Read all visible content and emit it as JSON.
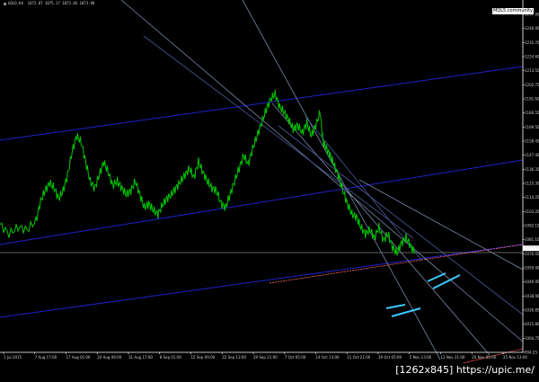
{
  "header": {
    "symbol_line": "GOLD,H4  1072.87 1075.17 1073.46 1073.90",
    "broker_tag": "MQL5.community",
    "watermark": "[1262x845] https://upic.me/"
  },
  "colors": {
    "background": "#000000",
    "price_line": "#00c800",
    "channel_blue": "#2020c8",
    "trend_grey": "#7888a8",
    "bid_line": "#808080",
    "pink_line": "#ff6c6c",
    "marker_cyan": "#3cc8ff",
    "axis": "#ffffff"
  },
  "chart_data": {
    "type": "line",
    "symbol": "GOLD",
    "timeframe": "H4",
    "ohlc": {
      "open": 1072.87,
      "high": 1075.17,
      "low": 1073.46,
      "close": 1073.9
    },
    "current_price": 1073.9,
    "y_range": [
      994.25,
      1257.0
    ],
    "y_ticks": [
      "1257.00",
      "1246.95",
      "1235.70",
      "1224.60",
      "1213.50",
      "1202.75",
      "1191.60",
      "1180.55",
      "1169.50",
      "1158.45",
      "1147.40",
      "1136.35",
      "1125.30",
      "1114.25",
      "1103.20",
      "1092.15",
      "1081.10",
      "1070.05",
      "1059.00",
      "1049.95",
      "1038.90",
      "1026.85",
      "1015.80",
      "1004.75",
      "994.25"
    ],
    "x_ticks": [
      "1 Jul 2015",
      "7 Aug 17:00",
      "17 Aug 01:00",
      "24 Aug 09:00",
      "31 Aug 17:00",
      "8 Sep 01:00",
      "15 Sep 09:00",
      "22 Sep 13:00",
      "29 Sep 21:00",
      "7 Oct 05:00",
      "14 Oct 13:00",
      "21 Oct 21:00",
      "29 Oct 05:00",
      "5 Nov 13:00",
      "12 Nov 21:00",
      "20 Nov 05:00",
      "25 Nov 13:00"
    ],
    "price_series": [
      [
        0,
        1092
      ],
      [
        10,
        1085
      ],
      [
        20,
        1090
      ],
      [
        30,
        1088
      ],
      [
        40,
        1095
      ],
      [
        45,
        1110
      ],
      [
        50,
        1118
      ],
      [
        55,
        1124
      ],
      [
        60,
        1120
      ],
      [
        65,
        1112
      ],
      [
        70,
        1118
      ],
      [
        75,
        1130
      ],
      [
        80,
        1148
      ],
      [
        85,
        1160
      ],
      [
        90,
        1155
      ],
      [
        95,
        1140
      ],
      [
        100,
        1125
      ],
      [
        105,
        1120
      ],
      [
        110,
        1130
      ],
      [
        115,
        1140
      ],
      [
        120,
        1132
      ],
      [
        125,
        1122
      ],
      [
        130,
        1125
      ],
      [
        135,
        1120
      ],
      [
        140,
        1115
      ],
      [
        145,
        1118
      ],
      [
        150,
        1125
      ],
      [
        155,
        1115
      ],
      [
        160,
        1105
      ],
      [
        165,
        1108
      ],
      [
        170,
        1103
      ],
      [
        175,
        1100
      ],
      [
        180,
        1107
      ],
      [
        185,
        1112
      ],
      [
        190,
        1115
      ],
      [
        195,
        1120
      ],
      [
        200,
        1125
      ],
      [
        205,
        1130
      ],
      [
        210,
        1135
      ],
      [
        215,
        1128
      ],
      [
        220,
        1140
      ],
      [
        225,
        1132
      ],
      [
        230,
        1125
      ],
      [
        235,
        1120
      ],
      [
        240,
        1118
      ],
      [
        245,
        1108
      ],
      [
        250,
        1105
      ],
      [
        255,
        1115
      ],
      [
        260,
        1125
      ],
      [
        265,
        1135
      ],
      [
        270,
        1145
      ],
      [
        275,
        1138
      ],
      [
        280,
        1150
      ],
      [
        285,
        1160
      ],
      [
        290,
        1170
      ],
      [
        295,
        1180
      ],
      [
        300,
        1188
      ],
      [
        305,
        1192
      ],
      [
        310,
        1182
      ],
      [
        315,
        1178
      ],
      [
        320,
        1172
      ],
      [
        325,
        1165
      ],
      [
        330,
        1168
      ],
      [
        335,
        1162
      ],
      [
        340,
        1170
      ],
      [
        345,
        1160
      ],
      [
        350,
        1168
      ],
      [
        355,
        1178
      ],
      [
        358,
        1155
      ],
      [
        362,
        1150
      ],
      [
        366,
        1145
      ],
      [
        370,
        1138
      ],
      [
        375,
        1130
      ],
      [
        380,
        1118
      ],
      [
        385,
        1108
      ],
      [
        390,
        1100
      ],
      [
        395,
        1098
      ],
      [
        400,
        1090
      ],
      [
        405,
        1085
      ],
      [
        410,
        1088
      ],
      [
        415,
        1082
      ],
      [
        420,
        1090
      ],
      [
        425,
        1080
      ],
      [
        430,
        1085
      ],
      [
        435,
        1075
      ],
      [
        440,
        1070
      ],
      [
        445,
        1078
      ],
      [
        450,
        1082
      ],
      [
        455,
        1076
      ],
      [
        460,
        1070
      ]
    ]
  }
}
